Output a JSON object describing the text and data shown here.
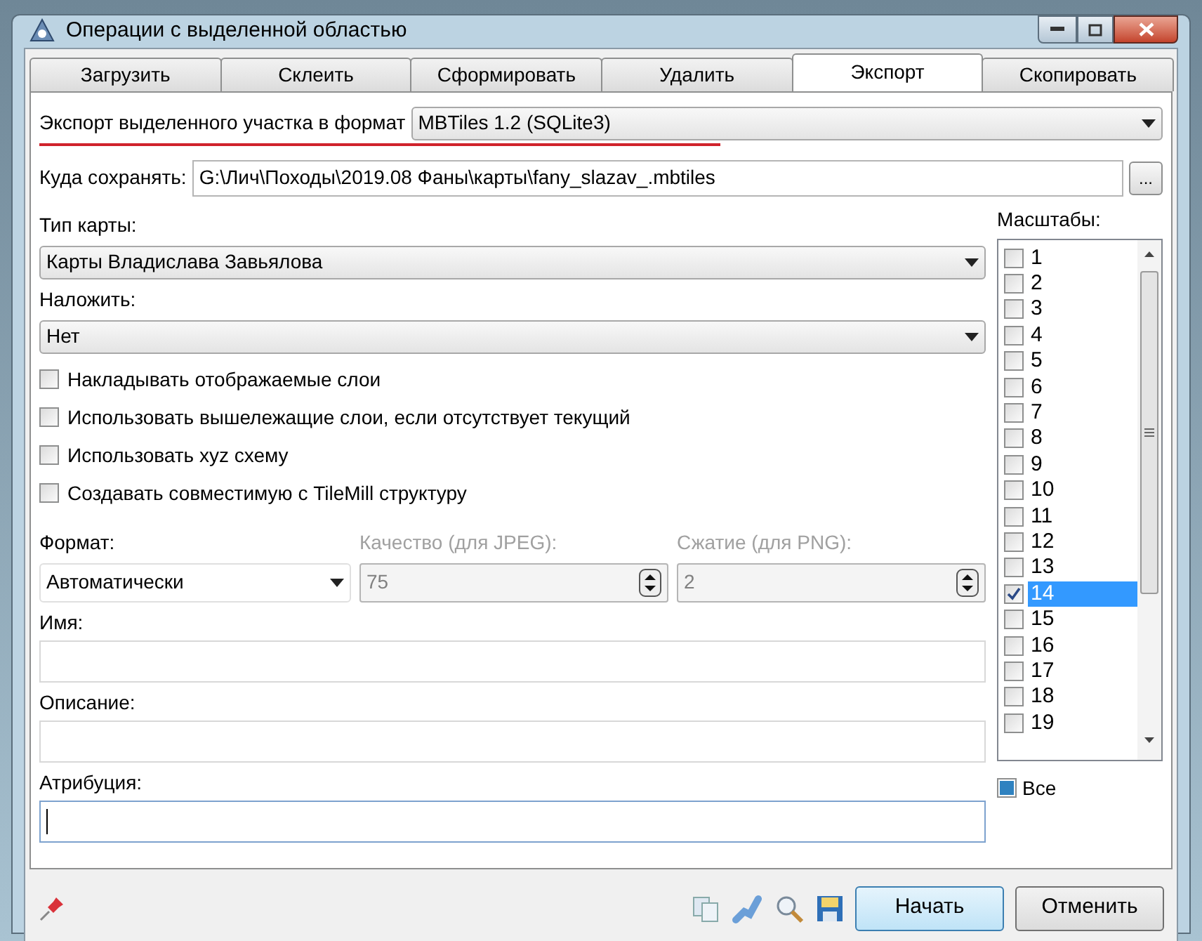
{
  "window": {
    "title": "Операции с выделенной областью"
  },
  "tabs": [
    {
      "label": "Загрузить",
      "selected": false
    },
    {
      "label": "Склеить",
      "selected": false
    },
    {
      "label": "Сформировать",
      "selected": false
    },
    {
      "label": "Удалить",
      "selected": false
    },
    {
      "label": "Экспорт",
      "selected": true
    },
    {
      "label": "Скопировать",
      "selected": false
    }
  ],
  "export_format": {
    "label": "Экспорт выделенного участка в формат",
    "value": "MBTiles 1.2 (SQLite3)",
    "underlined": true
  },
  "save_path": {
    "label": "Куда сохранять:",
    "value": "G:\\Лич\\Походы\\2019.08 Фаны\\карты\\fany_slazav_.mbtiles",
    "browse": "..."
  },
  "map_type": {
    "label": "Тип карты:",
    "value": "Карты Владислава Завьялова"
  },
  "overlay": {
    "label": "Наложить:",
    "value": "Нет"
  },
  "options": [
    {
      "label": "Накладывать отображаемые слои",
      "checked": false
    },
    {
      "label": "Использовать вышележащие слои, если отсутствует текущий",
      "checked": false
    },
    {
      "label": "Использовать xyz схему",
      "checked": false
    },
    {
      "label": "Создавать совместимую с TileMill структуру",
      "checked": false
    }
  ],
  "format": {
    "label": "Формат:",
    "value": "Автоматически"
  },
  "quality": {
    "label": "Качество (для JPEG):",
    "value": "75",
    "disabled": true
  },
  "compression": {
    "label": "Сжатие (для PNG):",
    "value": "2",
    "disabled": true
  },
  "fields": [
    {
      "label": "Имя:",
      "focused": false
    },
    {
      "label": "Описание:",
      "focused": false
    },
    {
      "label": "Атрибуция:",
      "focused": true
    }
  ],
  "scales": {
    "label": "Масштабы:",
    "items": [
      {
        "label": "1",
        "checked": false,
        "selected": false
      },
      {
        "label": "2",
        "checked": false,
        "selected": false
      },
      {
        "label": "3",
        "checked": false,
        "selected": false
      },
      {
        "label": "4",
        "checked": false,
        "selected": false
      },
      {
        "label": "5",
        "checked": false,
        "selected": false
      },
      {
        "label": "6",
        "checked": false,
        "selected": false
      },
      {
        "label": "7",
        "checked": false,
        "selected": false
      },
      {
        "label": "8",
        "checked": false,
        "selected": false
      },
      {
        "label": "9",
        "checked": false,
        "selected": false
      },
      {
        "label": "10",
        "checked": false,
        "selected": false
      },
      {
        "label": "11",
        "checked": false,
        "selected": false
      },
      {
        "label": "12",
        "checked": false,
        "selected": false
      },
      {
        "label": "13",
        "checked": false,
        "selected": false
      },
      {
        "label": "14",
        "checked": true,
        "selected": true
      },
      {
        "label": "15",
        "checked": false,
        "selected": false
      },
      {
        "label": "16",
        "checked": false,
        "selected": false
      },
      {
        "label": "17",
        "checked": false,
        "selected": false
      },
      {
        "label": "18",
        "checked": false,
        "selected": false
      },
      {
        "label": "19",
        "checked": false,
        "selected": false
      }
    ],
    "all": {
      "label": "Все",
      "indeterminate": true
    }
  },
  "buttons": [
    {
      "label": "Начать",
      "default": true
    },
    {
      "label": "Отменить",
      "default": false
    }
  ]
}
